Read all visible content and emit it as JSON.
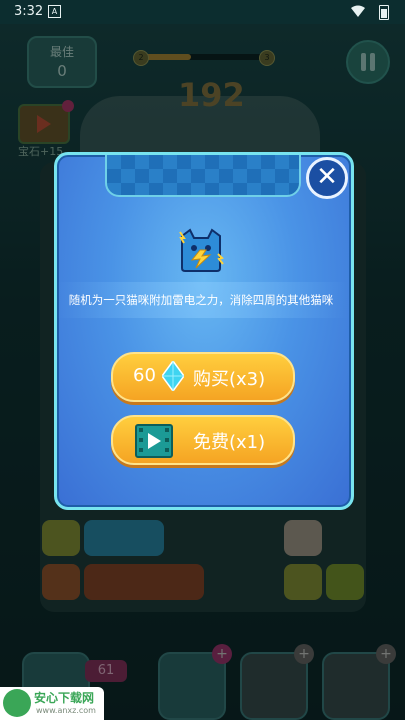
{
  "status_bar": {
    "time": "3:32",
    "notification_icon": "A"
  },
  "hud": {
    "best_label": "最佳",
    "best_value": "0",
    "score": "192",
    "level_from": "2",
    "level_to": "3",
    "progress_fraction": 0.4,
    "gem_bonus": "宝石+15"
  },
  "dialog": {
    "description": "随机为一只猫咪附加雷电之力，消除四周的其他猫咪",
    "buy_price": "60",
    "buy_label": "购买(x3)",
    "free_label": "免费(x1)"
  },
  "bottom_bar": {
    "item_count": "61"
  },
  "watermark": {
    "name": "安心下载网",
    "url": "www.anxz.com"
  },
  "colors": {
    "dialog_blue": "#4a93e6",
    "button_orange": "#f5a423",
    "border_cyan": "#78e4ef"
  },
  "icons": [
    "pause-icon",
    "close-icon",
    "diamond-icon",
    "video-play-icon",
    "lightning-cat-icon",
    "plus-icon"
  ]
}
